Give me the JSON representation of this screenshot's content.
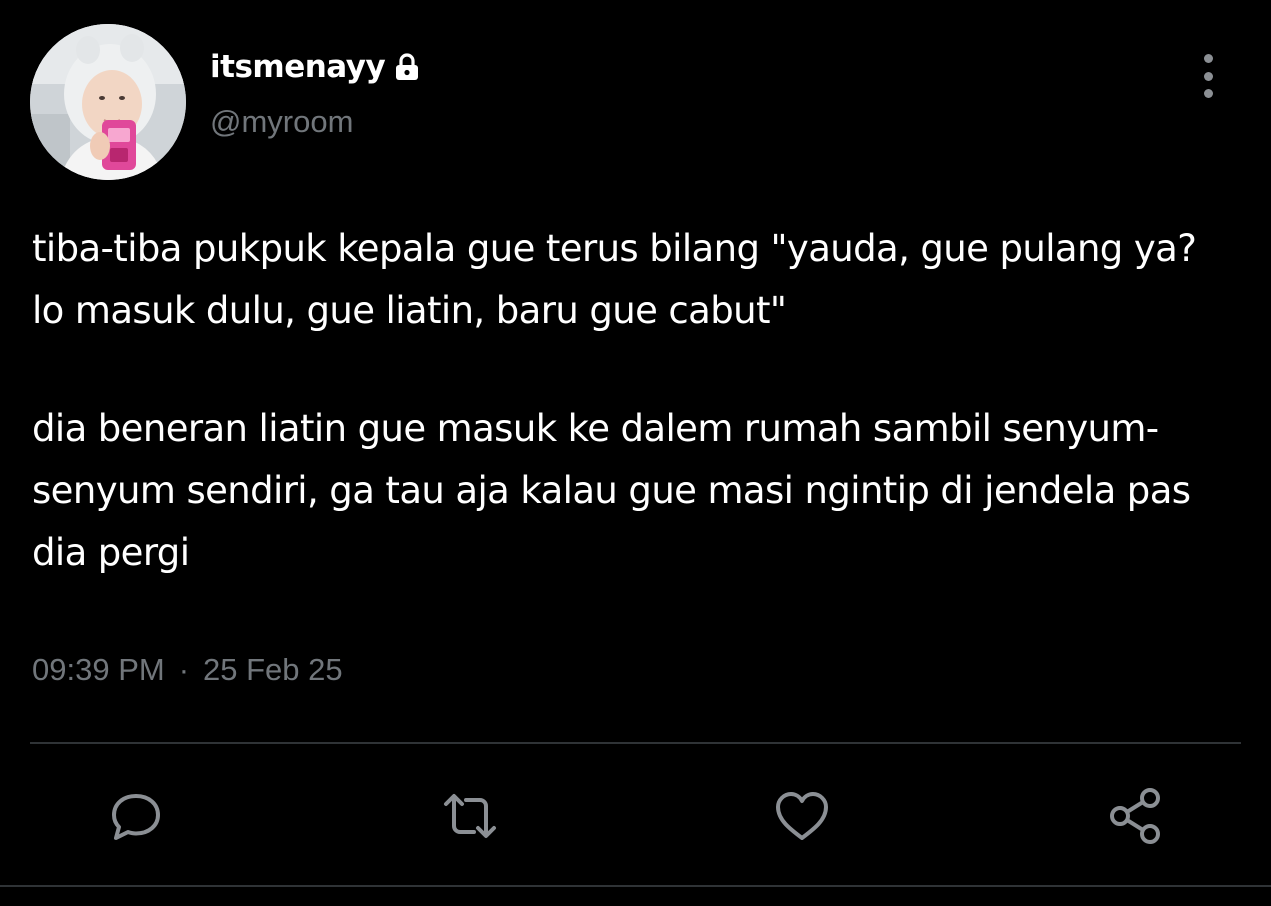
{
  "user": {
    "display_name": "itsmenayy",
    "handle": "@myroom",
    "locked_icon": "lock-icon",
    "avatar_icon": "avatar"
  },
  "tweet": {
    "paragraphs": [
      "tiba-tiba pukpuk kepala gue terus bilang \"yauda, gue pulang ya? lo masuk dulu, gue liatin, baru gue cabut\"",
      "dia beneran liatin gue masuk ke dalem rumah sambil senyum-senyum sendiri, ga tau aja kalau gue masi ngintip di jendela pas dia pergi"
    ],
    "time": "09:39 PM",
    "separator": "·",
    "date": "25 Feb 25"
  },
  "actions": {
    "reply_icon": "reply-icon",
    "retweet_icon": "retweet-icon",
    "like_icon": "heart-icon",
    "share_icon": "share-icon",
    "more_icon": "more-vertical-icon"
  },
  "colors": {
    "background": "#000000",
    "text": "#ffffff",
    "secondary": "#71767b",
    "divider": "#2f3336",
    "icon": "#8b8f94"
  }
}
